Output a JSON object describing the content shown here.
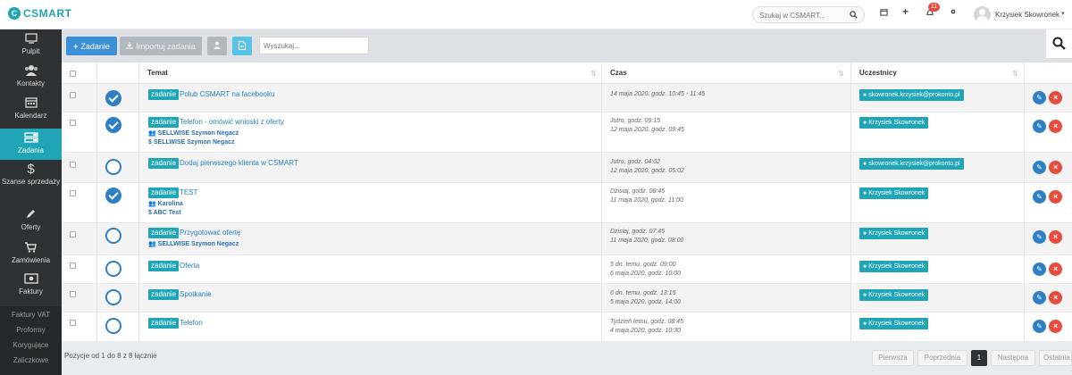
{
  "app": {
    "logo_letter": "C",
    "logo_text": "CSMART",
    "search_placeholder": "Szukaj w CSMART...",
    "notification_count": "11",
    "user_name": "Krzysiek Skowronek"
  },
  "sidebar": {
    "items": [
      {
        "label": "Pulpit",
        "icon": "monitor-icon"
      },
      {
        "label": "Kontakty",
        "icon": "users-icon"
      },
      {
        "label": "Kalendarz",
        "icon": "calendar-icon"
      },
      {
        "label": "Zadania",
        "icon": "tasks-icon",
        "active": true
      },
      {
        "label": "Szanse sprzedaży",
        "icon": "dollar-icon"
      },
      {
        "label": "Oferty",
        "icon": "pencil-icon"
      },
      {
        "label": "Zamówienia",
        "icon": "cart-icon"
      },
      {
        "label": "Faktury",
        "icon": "money-icon"
      }
    ],
    "subitems": [
      "Faktury VAT",
      "Proformy",
      "Korygujące",
      "Zaliczkowe"
    ]
  },
  "toolbar": {
    "add_label": "Zadanie",
    "import_label": "Importuj zadania",
    "search_placeholder": "Wyszukaj..."
  },
  "table": {
    "headers": {
      "topic": "Temat",
      "time": "Czas",
      "participants": "Uczestnicy"
    },
    "tag_label": "zadanie",
    "rows": [
      {
        "done": true,
        "title": "Polub CSMART na facebooku",
        "contact": "",
        "deal": "",
        "time1": "14 maja 2020, godz. 10:45 - 11:45",
        "time2": "",
        "participant": "skowronek.krzysiek@prokonto.pl"
      },
      {
        "done": true,
        "title": "Telefon - omówić wnioski z oferty",
        "contact": "SELLWISE Szymon Negacz",
        "deal": "SELLWISE Szymon Negacz",
        "time1": "Jutro, godz. 09:15",
        "time2": "12 maja 2020, godz. 09:45",
        "participant": "Krzysiek Skowronek"
      },
      {
        "done": false,
        "title": "Dodaj pierwszego klienta w CSMART",
        "contact": "",
        "deal": "",
        "time1": "Jutro, godz. 04:02",
        "time2": "12 maja 2020, godz. 05:02",
        "participant": "skowronek.krzysiek@prokonto.pl"
      },
      {
        "done": true,
        "title": "TEST",
        "contact": "Karolina",
        "deal": "ABC Test",
        "time1": "Dzisiaj, godz. 08:45",
        "time2": "11 maja 2020, godz. 11:00",
        "participant": "Krzysiek Skowronek"
      },
      {
        "done": false,
        "title": "Przygotować ofertę",
        "contact": "SELLWISE Szymon Negacz",
        "deal": "",
        "time1": "Dzisiaj, godz. 07:45",
        "time2": "11 maja 2020, godz. 08:00",
        "participant": "Krzysiek Skowronek"
      },
      {
        "done": false,
        "title": "Oferta",
        "contact": "",
        "deal": "",
        "time1": "5 dn. temu, godz. 09:00",
        "time2": "6 maja 2020, godz. 10:00",
        "participant": "Krzysiek Skowronek"
      },
      {
        "done": false,
        "title": "Spotkanie",
        "contact": "",
        "deal": "",
        "time1": "6 dn. temu, godz. 13:15",
        "time2": "5 maja 2020, godz. 14:00",
        "participant": "Krzysiek Skowronek"
      },
      {
        "done": false,
        "title": "Telefon",
        "contact": "",
        "deal": "",
        "time1": "Tydzień temu, godz. 08:45",
        "time2": "4 maja 2020, godz. 10:30",
        "participant": "Krzysiek Skowronek"
      }
    ]
  },
  "footer": {
    "position_text": "Pozycje od 1 do 8 z 8 łącznie",
    "pagination": {
      "first": "Pierwsza",
      "prev": "Poprzednia",
      "current": "1",
      "next": "Następna",
      "last": "Ostatnia"
    }
  }
}
